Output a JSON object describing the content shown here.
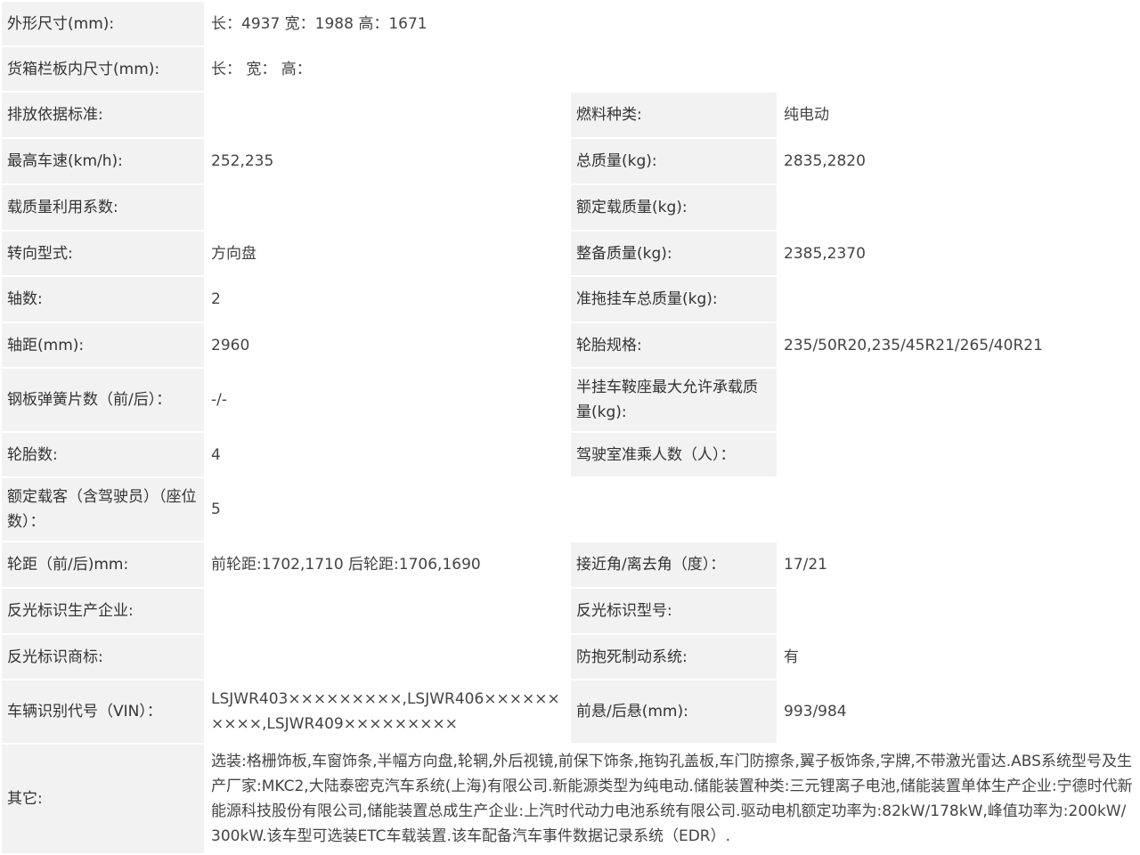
{
  "rows": {
    "dimensions": {
      "label": "外形尺寸(mm):",
      "value": "长：4937 宽：1988 高：1671"
    },
    "cargo_box": {
      "label": "货箱栏板内尺寸(mm):",
      "value": "长：  宽：  高："
    },
    "emission_standard": {
      "label": "排放依据标准:",
      "value": ""
    },
    "fuel_type": {
      "label": "燃料种类:",
      "value": "纯电动"
    },
    "max_speed": {
      "label": "最高车速(km/h):",
      "value": "252,235"
    },
    "total_mass": {
      "label": "总质量(kg):",
      "value": "2835,2820"
    },
    "load_utilization": {
      "label": "载质量利用系数:",
      "value": ""
    },
    "rated_load": {
      "label": "额定载质量(kg):",
      "value": ""
    },
    "steering": {
      "label": "转向型式:",
      "value": "方向盘"
    },
    "curb_mass": {
      "label": "整备质量(kg):",
      "value": "2385,2370"
    },
    "axles": {
      "label": "轴数:",
      "value": "2"
    },
    "trailer_mass": {
      "label": "准拖挂车总质量(kg):",
      "value": ""
    },
    "wheelbase": {
      "label": "轴距(mm):",
      "value": "2960"
    },
    "tire_spec": {
      "label": "轮胎规格:",
      "value": "235/50R20,235/45R21/265/40R21"
    },
    "leaf_springs": {
      "label": "钢板弹簧片数（前/后）：",
      "value": "-/-"
    },
    "saddle_load": {
      "label": "半挂车鞍座最大允许承载质量(kg):",
      "value": ""
    },
    "tire_count": {
      "label": "轮胎数:",
      "value": "4"
    },
    "cab_passengers": {
      "label": "驾驶室准乘人数（人）：",
      "value": ""
    },
    "seats": {
      "label": "额定载客（含驾驶员）（座位数）：",
      "value": "5"
    },
    "track": {
      "label": "轮距（前/后)mm:",
      "value": "前轮距:1702,1710 后轮距:1706,1690"
    },
    "angles": {
      "label": "接近角/离去角（度）：",
      "value": "17/21"
    },
    "reflector_maker": {
      "label": "反光标识生产企业:",
      "value": ""
    },
    "reflector_model": {
      "label": "反光标识型号:",
      "value": ""
    },
    "reflector_brand": {
      "label": "反光标识商标:",
      "value": ""
    },
    "abs": {
      "label": "防抱死制动系统:",
      "value": "有"
    },
    "vin": {
      "label": "车辆识别代号（VIN）：",
      "value": "LSJWR403×××××××××,LSJWR406××××××××××,LSJWR409×××××××××"
    },
    "overhang": {
      "label": "前悬/后悬(mm):",
      "value": "993/984"
    },
    "other": {
      "label": "其它:",
      "value": "选装:格栅饰板,车窗饰条,半幅方向盘,轮辋,外后视镜,前保下饰条,拖钩孔盖板,车门防擦条,翼子板饰条,字牌,不带激光雷达.ABS系统型号及生产厂家:MKC2,大陆泰密克汽车系统(上海)有限公司.新能源类型为纯电动.储能装置种类:三元锂离子电池,储能装置单体生产企业:宁德时代新能源科技股份有限公司,储能装置总成生产企业:上汽时代动力电池系统有限公司.驱动电机额定功率为:82kW/178kW,峰值功率为:200kW/300kW.该车型可选装ETC车载装置.该车配备汽车事件数据记录系统（EDR）."
    }
  }
}
